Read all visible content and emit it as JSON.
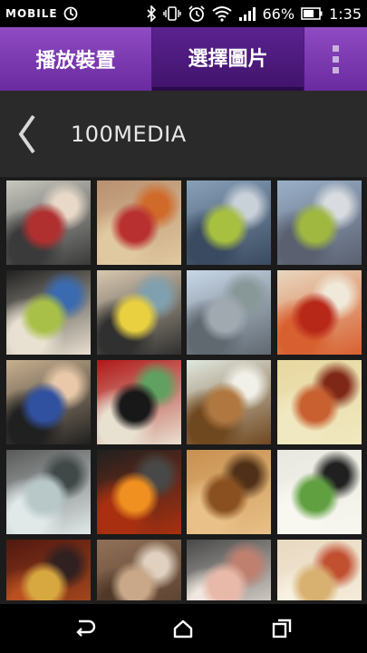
{
  "status_bar": {
    "carrier": "MOBILE",
    "battery_percent": "66%",
    "time": "1:35",
    "icons": [
      "carrier-logo",
      "sync-icon",
      "bluetooth-icon",
      "vibrate-icon",
      "alarm-icon",
      "wifi-icon",
      "signal-icon",
      "battery-icon"
    ]
  },
  "tabs": [
    {
      "label": "播放裝置",
      "active": false
    },
    {
      "label": "選擇圖片",
      "active": true
    }
  ],
  "overflow_menu_icon": "more-vert-icon",
  "folder": {
    "back_icon": "chevron-left-icon",
    "title": "100MEDIA"
  },
  "photos": [
    {
      "name": "photo-child-red-vest-toys",
      "colors": [
        "#c8c8c0",
        "#b03030",
        "#3a3a3a",
        "#e8d8c8"
      ]
    },
    {
      "name": "photo-child-basketball",
      "colors": [
        "#b89070",
        "#b83030",
        "#e0c8a0",
        "#d06a2a"
      ]
    },
    {
      "name": "photo-child-green-jacket-slide",
      "colors": [
        "#88a0b8",
        "#a8c040",
        "#3a4a60",
        "#c8d0d8"
      ]
    },
    {
      "name": "photo-child-green-jacket-railing",
      "colors": [
        "#9ab0c8",
        "#a0b840",
        "#5a6070",
        "#d8dce0"
      ]
    },
    {
      "name": "photo-child-car-seat",
      "colors": [
        "#202020",
        "#a8c048",
        "#e8e0d0",
        "#3a6ab0"
      ]
    },
    {
      "name": "photo-child-yellow-ride",
      "colors": [
        "#d8c8b0",
        "#e8d040",
        "#303030",
        "#80a0b0"
      ]
    },
    {
      "name": "photo-bridge-family",
      "colors": [
        "#c8d8e8",
        "#a0a8b0",
        "#606870",
        "#889898"
      ]
    },
    {
      "name": "photo-food-chili-plate",
      "colors": [
        "#e8d8c0",
        "#b82818",
        "#d86030",
        "#f0e8d8"
      ]
    },
    {
      "name": "photo-woman-and-child",
      "colors": [
        "#c8b090",
        "#3050a0",
        "#202020",
        "#e8c8a8"
      ]
    },
    {
      "name": "photo-meatball-shop-sign",
      "colors": [
        "#b01818",
        "#181818",
        "#e8e0d0",
        "#60a060"
      ]
    },
    {
      "name": "photo-food-fried-pork-rice",
      "colors": [
        "#e0e8e0",
        "#b07840",
        "#704820",
        "#f0f0e8"
      ]
    },
    {
      "name": "photo-food-noodle-soup",
      "colors": [
        "#e8d8a0",
        "#c86030",
        "#f0e8c0",
        "#802818"
      ]
    },
    {
      "name": "photo-food-dumplings",
      "colors": [
        "#585858",
        "#b8c8c8",
        "#e0e8e8",
        "#404848"
      ]
    },
    {
      "name": "photo-food-bbq-grill",
      "colors": [
        "#202020",
        "#f09020",
        "#a83010",
        "#484848"
      ]
    },
    {
      "name": "photo-food-grilled-skewers",
      "colors": [
        "#c89050",
        "#8a5020",
        "#e8c088",
        "#503018"
      ]
    },
    {
      "name": "photo-food-fish-balls",
      "colors": [
        "#e8e8e0",
        "#60a040",
        "#f8f8f0",
        "#202020"
      ]
    },
    {
      "name": "photo-tea-shop-sign",
      "colors": [
        "#501810",
        "#d8a840",
        "#b85020",
        "#302020"
      ]
    },
    {
      "name": "photo-shop-storefront",
      "colors": [
        "#907058",
        "#c8a888",
        "#503828",
        "#e0d0c0"
      ]
    },
    {
      "name": "photo-food-ham-sandwich",
      "colors": [
        "#484848",
        "#e8b8a8",
        "#f0e8e0",
        "#c08070"
      ]
    },
    {
      "name": "photo-food-sandwich-plate",
      "colors": [
        "#e8d8c0",
        "#d8b070",
        "#f8f0e0",
        "#c05030"
      ]
    }
  ],
  "nav_bar": {
    "back_icon": "nav-back-icon",
    "home_icon": "nav-home-icon",
    "recents_icon": "nav-recents-icon"
  }
}
